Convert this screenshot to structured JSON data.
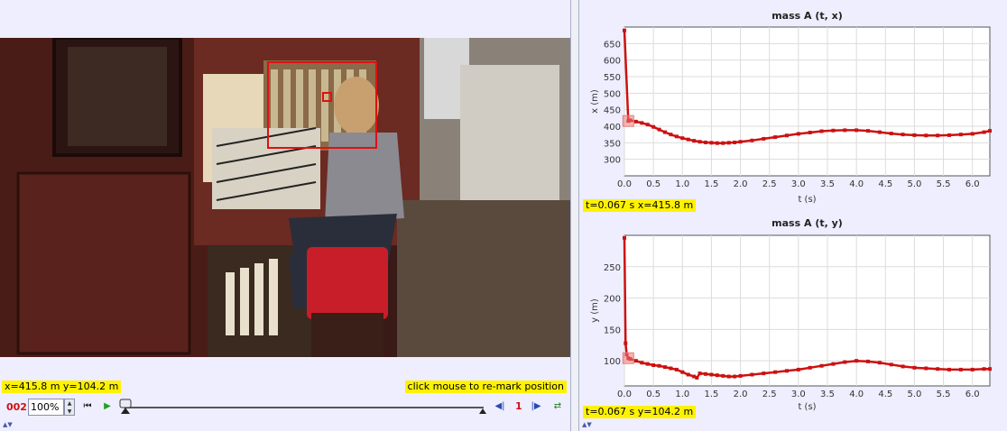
{
  "video": {
    "coord_readout": "x=415.8 m  y=104.2 m",
    "remark_hint": "click mouse to re-mark position"
  },
  "player": {
    "frame_number": "002",
    "zoom_value": "100%",
    "step_size": "1",
    "slider_position_fraction": 0.0
  },
  "icons": {
    "go_start": "go-to-start-icon",
    "play": "play-icon",
    "step_back": "step-back-icon",
    "step_forward": "step-forward-icon",
    "loop": "loop-icon"
  },
  "colors": {
    "track_red": "#cc1111",
    "highlight": "#fff200",
    "panel_bg": "#eeeeff"
  },
  "chart_data": [
    {
      "type": "scatter",
      "title": "mass A (t, x)",
      "xlabel": "t (s)",
      "ylabel": "x (m)",
      "xlim": [
        0,
        6.3
      ],
      "ylim": [
        250,
        700
      ],
      "xticks": [
        0.0,
        0.5,
        1.0,
        1.5,
        2.0,
        2.5,
        3.0,
        3.5,
        4.0,
        4.5,
        5.0,
        5.5,
        6.0
      ],
      "xtick_labels": [
        "0.0",
        "0.5",
        "1.0",
        "1.5",
        "2.0",
        "2.5",
        "3.0",
        "3.5",
        "4.0",
        "4.5",
        "5.0",
        "5.5",
        "6.0"
      ],
      "yticks": [
        300,
        350,
        400,
        450,
        500,
        550,
        600,
        650
      ],
      "ytick_labels": [
        "300",
        "350",
        "400",
        "450",
        "500",
        "550",
        "600",
        "650"
      ],
      "grid": true,
      "readout": "t=0.067 s  x=415.8 m",
      "x": [
        0.0,
        0.067,
        0.1,
        0.2,
        0.3,
        0.4,
        0.5,
        0.6,
        0.7,
        0.8,
        0.9,
        1.0,
        1.1,
        1.2,
        1.3,
        1.4,
        1.5,
        1.6,
        1.7,
        1.8,
        1.9,
        2.0,
        2.2,
        2.4,
        2.6,
        2.8,
        3.0,
        3.2,
        3.4,
        3.6,
        3.8,
        4.0,
        4.2,
        4.4,
        4.6,
        4.8,
        5.0,
        5.2,
        5.4,
        5.6,
        5.8,
        6.0,
        6.2,
        6.3
      ],
      "y": [
        690,
        415.8,
        418,
        414,
        410,
        405,
        398,
        390,
        382,
        375,
        369,
        364,
        360,
        356,
        353,
        351,
        350,
        349,
        349,
        350,
        351,
        353,
        357,
        362,
        367,
        372,
        377,
        381,
        385,
        387,
        388,
        388,
        386,
        382,
        378,
        375,
        373,
        372,
        372,
        373,
        375,
        377,
        382,
        386
      ]
    },
    {
      "type": "scatter",
      "title": "mass A (t, y)",
      "xlabel": "t (s)",
      "ylabel": "y (m)",
      "xlim": [
        0,
        6.3
      ],
      "ylim": [
        60,
        300
      ],
      "xticks": [
        0.0,
        0.5,
        1.0,
        1.5,
        2.0,
        2.5,
        3.0,
        3.5,
        4.0,
        4.5,
        5.0,
        5.5,
        6.0
      ],
      "xtick_labels": [
        "0.0",
        "0.5",
        "1.0",
        "1.5",
        "2.0",
        "2.5",
        "3.0",
        "3.5",
        "4.0",
        "4.5",
        "5.0",
        "5.5",
        "6.0"
      ],
      "yticks": [
        100,
        150,
        200,
        250
      ],
      "ytick_labels": [
        "100",
        "150",
        "200",
        "250"
      ],
      "grid": true,
      "readout": "t=0.067 s  y=104.2 m",
      "x": [
        0.0,
        0.02,
        0.04,
        0.067,
        0.1,
        0.2,
        0.3,
        0.4,
        0.5,
        0.6,
        0.7,
        0.8,
        0.9,
        1.0,
        1.1,
        1.2,
        1.25,
        1.3,
        1.4,
        1.5,
        1.6,
        1.7,
        1.8,
        1.9,
        2.0,
        2.2,
        2.4,
        2.6,
        2.8,
        3.0,
        3.2,
        3.4,
        3.6,
        3.8,
        4.0,
        4.2,
        4.4,
        4.6,
        4.8,
        5.0,
        5.2,
        5.4,
        5.6,
        5.8,
        6.0,
        6.2,
        6.3
      ],
      "y": [
        296,
        128,
        110,
        104.2,
        103,
        100,
        97,
        95,
        93,
        92,
        90,
        88,
        86,
        82,
        78,
        75,
        73,
        80,
        79,
        78,
        77,
        76,
        75,
        75,
        76,
        78,
        80,
        82,
        84,
        86,
        89,
        92,
        95,
        98,
        100,
        99,
        97,
        94,
        91,
        89,
        88,
        87,
        86,
        86,
        86,
        87,
        87
      ]
    }
  ]
}
